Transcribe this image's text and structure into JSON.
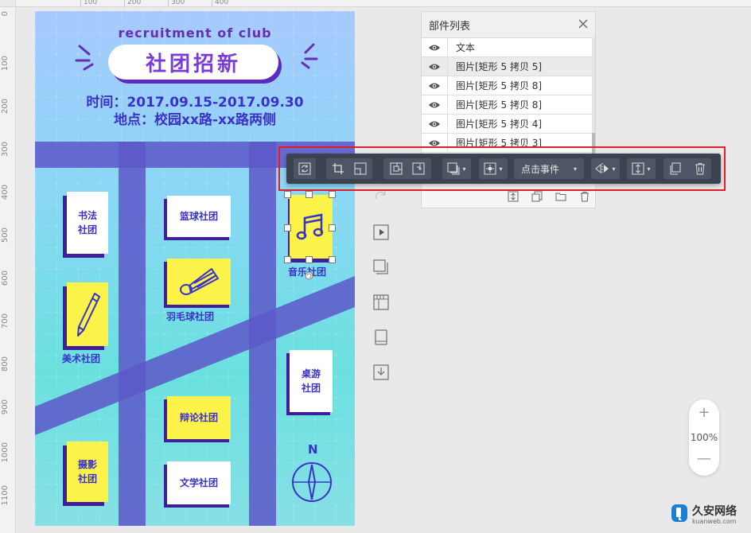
{
  "ruler": {
    "left_numbers": [
      "0",
      "100",
      "200",
      "300",
      "400",
      "500",
      "600",
      "700",
      "800",
      "900",
      "1000",
      "1100"
    ],
    "top_numbers": [
      "100",
      "200",
      "300",
      "400"
    ]
  },
  "poster": {
    "subtitle": "recruitment of club",
    "title": "社团招新",
    "date_line": "时间：2017.09.15-2017.09.30",
    "place_line": "地点：校园xx路-xx路两侧",
    "clubs": {
      "calligraphy": "书法\n社团",
      "basketball": "篮球社团",
      "music": "音乐社团",
      "badminton": "羽毛球社团",
      "art": "美术社团",
      "boardgame": "桌游\n社团",
      "debate": "辩论社团",
      "photo": "摄影\n社团",
      "literature": "文学社团"
    },
    "compass_letter": "N",
    "colors": {
      "blue_text": "#3a32c8",
      "purple": "#6530b0",
      "yellow": "#fbf24a",
      "road": "#5d57c9"
    }
  },
  "toolbar": {
    "event_label": "点击事件",
    "buttons": [
      "replace-icon",
      "crop-icon",
      "resize-icon",
      "bring-forward-icon",
      "send-backward-icon",
      "shadow-icon",
      "position-icon",
      "event-dropdown",
      "flip-icon",
      "align-icon",
      "duplicate-icon",
      "trash-icon"
    ]
  },
  "layer_panel": {
    "title": "部件列表",
    "rows": [
      {
        "name": "文本"
      },
      {
        "name": "图片[矩形 5 拷贝 5]"
      },
      {
        "name": "图片[矩形 5 拷贝 8]"
      },
      {
        "name": "图片[矩形 5 拷贝 8]"
      },
      {
        "name": "图片[矩形 5 拷贝 4]"
      },
      {
        "name": "图片[矩形 5 拷贝 3]"
      }
    ]
  },
  "zoom": {
    "plus": "+",
    "value": "100%",
    "minus": "—"
  },
  "watermark": {
    "title": "久安网络",
    "url": "kuanweb.com"
  }
}
